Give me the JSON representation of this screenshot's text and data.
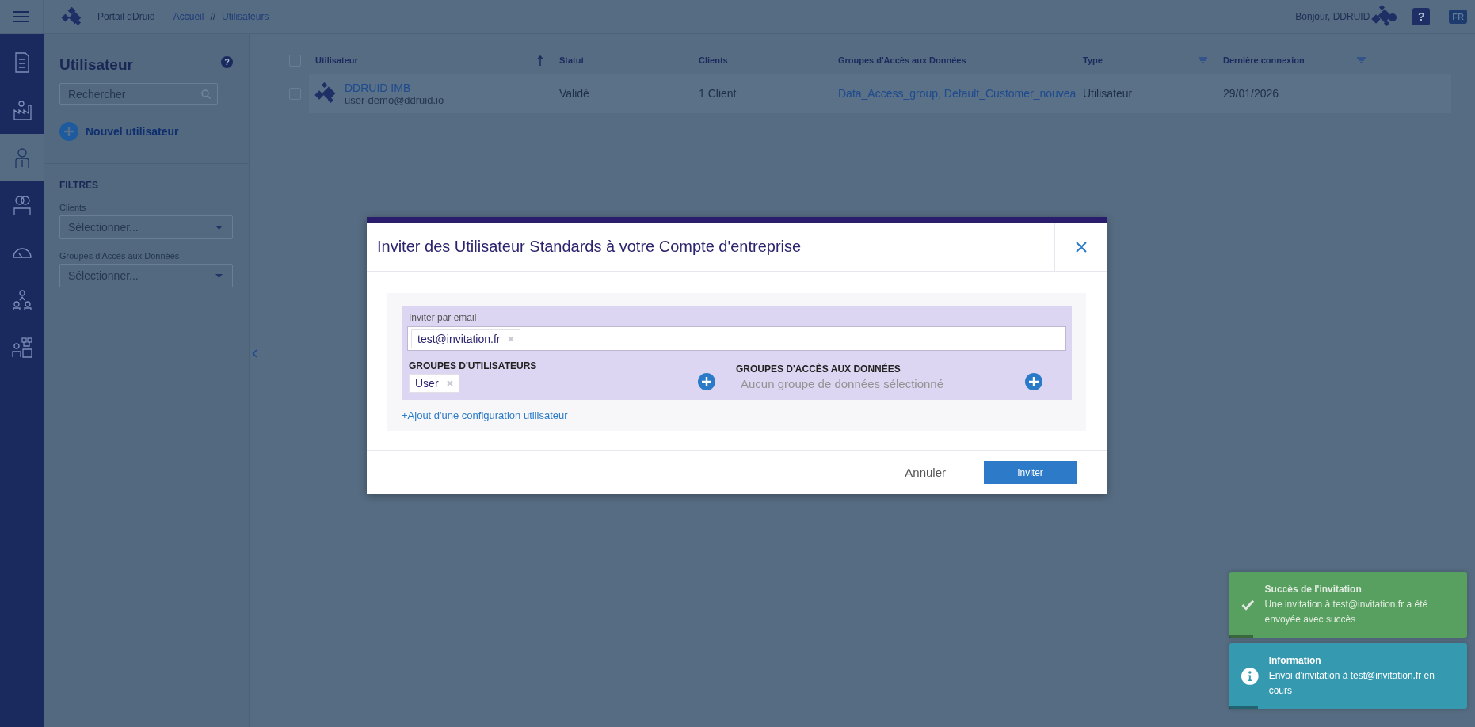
{
  "topbar": {
    "app_name": "Portail dDruid",
    "breadcrumbs": [
      "Accueil",
      "Utilisateurs"
    ],
    "separator": "//",
    "greeting": "Bonjour, DDRUID",
    "language": "FR",
    "help": "?"
  },
  "rail": [
    {
      "kind": "checklist",
      "selected": false
    },
    {
      "kind": "factory",
      "selected": false
    },
    {
      "kind": "person",
      "selected": true
    },
    {
      "kind": "people",
      "selected": false
    },
    {
      "kind": "gauge",
      "selected": false
    },
    {
      "kind": "hierarchy",
      "selected": false
    },
    {
      "kind": "network",
      "selected": false
    }
  ],
  "filter_panel": {
    "title": "Utilisateur",
    "help": "?",
    "search": {
      "placeholder": "Rechercher"
    },
    "new_button": "Nouvel utilisateur",
    "filters_heading": "FILTRES",
    "filters": [
      {
        "label": "Clients",
        "placeholder": "Sélectionner..."
      },
      {
        "label": "Groupes d'Accès aux Données",
        "placeholder": "Sélectionner..."
      }
    ]
  },
  "table": {
    "all_selected": false,
    "columns": [
      {
        "label": "Utilisateur",
        "kind": "sortable"
      },
      {
        "label": "Statut",
        "kind": "plain"
      },
      {
        "label": "Clients",
        "kind": "plain"
      },
      {
        "label": "Groupes d'Accès aux Données",
        "kind": "plain"
      },
      {
        "label": "Type",
        "kind": "filterable"
      },
      {
        "label": "Dernière connexion",
        "kind": "filterable"
      }
    ],
    "rows": [
      {
        "checked": false,
        "name": "DDRUID IMB",
        "email": "user-demo@ddruid.io",
        "status": "Validé",
        "clients": "1 Client",
        "groups": "Data_Access_group, Default_Customer_nouvea",
        "type": "Utilisateur",
        "last_login": "29/01/2026"
      }
    ]
  },
  "modal": {
    "title": "Inviter des Utilisateur Standards à votre Compte d'entreprise",
    "email_label": "Inviter par email",
    "email_tags": [
      "test@invitation.fr"
    ],
    "user_groups": {
      "heading": "GROUPES D'UTILISATEURS",
      "tags": [
        "User"
      ]
    },
    "data_groups": {
      "heading": "GROUPES D'ACCÈS AUX DONNÉES",
      "placeholder": "Aucun groupe de données sélectionné"
    },
    "add_config": "+Ajout d'une configuration utilisateur",
    "cancel": "Annuler",
    "submit": "Inviter"
  },
  "toasts": [
    {
      "kind": "success",
      "title": "Succès de l'invitation",
      "message": "Une invitation à test@invitation.fr a été envoyée avec succès",
      "level": 0.1
    },
    {
      "kind": "info",
      "title": "Information",
      "message": "Envoi d'invitation à test@invitation.fr en cours",
      "level": 0.12
    }
  ]
}
